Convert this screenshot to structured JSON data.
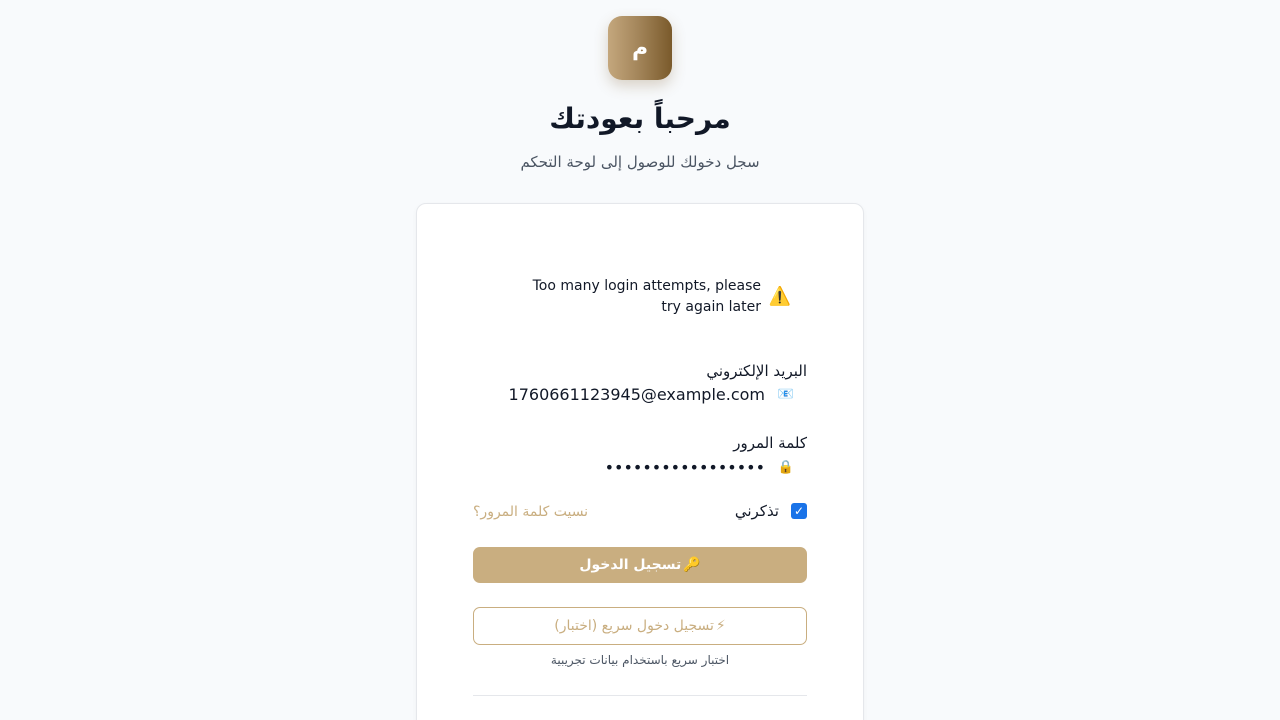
{
  "brand": {
    "logo_letter": "م"
  },
  "header": {
    "title": "مرحباً بعودتك",
    "subtitle": "سجل دخولك للوصول إلى لوحة التحكم"
  },
  "alert": {
    "icon": "warning-icon",
    "icon_glyph": "⚠️",
    "message": "Too many login attempts, please try again later"
  },
  "form": {
    "email": {
      "label": "البريد الإلكتروني",
      "icon": "mail-icon",
      "icon_glyph": "📧",
      "value": "1760661123945@example.com"
    },
    "password": {
      "label": "كلمة المرور",
      "icon": "lock-icon",
      "icon_glyph": "🔒",
      "value": "•••••••••••••••••"
    },
    "remember_me": {
      "label": "تذكرني",
      "checked": true
    },
    "forgot_password": "نسيت كلمة المرور؟",
    "login_button": {
      "icon": "key-icon",
      "icon_glyph": "🔑",
      "label": "تسجيل الدخول"
    },
    "quick_login_button": {
      "icon": "lightning-icon",
      "icon_glyph": "⚡",
      "label": "تسجيل دخول سريع (اختبار)"
    },
    "quick_login_hint": "اختبار سريع باستخدام بيانات تجريبية"
  },
  "colors": {
    "accent": "#c9ae80",
    "checkbox": "#1a73e8",
    "background": "#f8fafc"
  }
}
